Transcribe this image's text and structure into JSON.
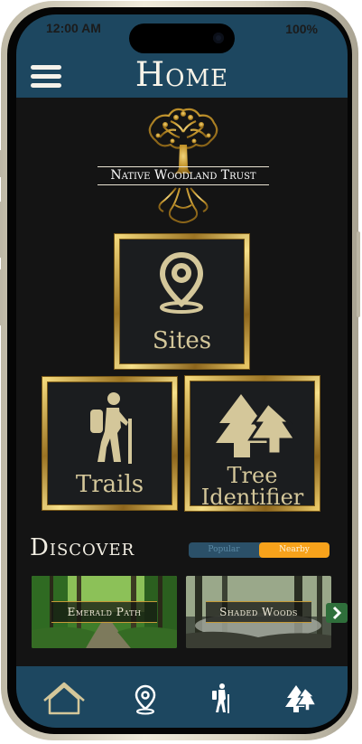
{
  "status": {
    "time": "12:00 AM",
    "battery": "100%"
  },
  "header": {
    "title": "Home",
    "menu_icon": "hamburger-menu-icon"
  },
  "logo": {
    "text": "Native Woodland Trust",
    "icon": "oak-tree-logo"
  },
  "tiles": [
    {
      "label": "Sites",
      "icon": "map-pin-icon"
    },
    {
      "label": "Trails",
      "icon": "hiker-icon"
    },
    {
      "label_line1": "Tree",
      "label_line2": "Identifier",
      "icon": "pine-trees-icon"
    }
  ],
  "discover": {
    "title": "Discover",
    "toggle": {
      "options": [
        "Popular",
        "Nearby"
      ],
      "selected": "Nearby"
    },
    "cards": [
      {
        "label": "Emerald Path",
        "image": "forest-path-photo"
      },
      {
        "label": "Shaded Woods",
        "image": "misty-forest-photo"
      }
    ],
    "next_icon": "chevron-right-icon"
  },
  "bottom_nav": [
    {
      "name": "home",
      "icon": "home-icon"
    },
    {
      "name": "sites",
      "icon": "map-pin-icon"
    },
    {
      "name": "trails",
      "icon": "hiker-icon"
    },
    {
      "name": "trees",
      "icon": "pine-trees-icon"
    }
  ],
  "colors": {
    "header_blue": "#1d4760",
    "gold": "#c69d38",
    "tile_text": "#d4c79a",
    "toggle_active": "#f7a21b",
    "background": "#141414"
  }
}
